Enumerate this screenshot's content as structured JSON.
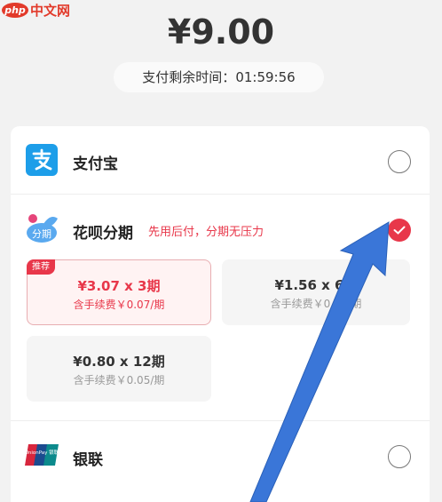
{
  "watermark": {
    "badge": "php",
    "text": "中文网"
  },
  "payment": {
    "amount": "¥9.00",
    "timer_label": "支付剩余时间：",
    "timer_value": "01:59:56"
  },
  "methods": [
    {
      "label": "支付宝",
      "icon": "alipay-icon",
      "selected": false
    },
    {
      "label": "花呗分期",
      "icon": "huabei-icon",
      "subtitle": "先用后付，分期无压力",
      "icon_text": "分期",
      "selected": true
    },
    {
      "label": "银联",
      "icon": "unionpay-icon",
      "icon_text": "UnionPay 银联",
      "selected": false
    }
  ],
  "plans": [
    {
      "title": "¥3.07 x 3期",
      "fee": "含手续费￥0.07/期",
      "tag": "推荐",
      "selected": true
    },
    {
      "title": "¥1.56 x 6期",
      "fee": "含手续费￥0.07/期",
      "selected": false
    },
    {
      "title": "¥0.80 x 12期",
      "fee": "含手续费￥0.05/期",
      "selected": false
    }
  ],
  "colors": {
    "accent": "#e8374a",
    "alipay": "#1d9ee9",
    "arrow": "#3a76d8",
    "background": "#f2f2f2"
  }
}
